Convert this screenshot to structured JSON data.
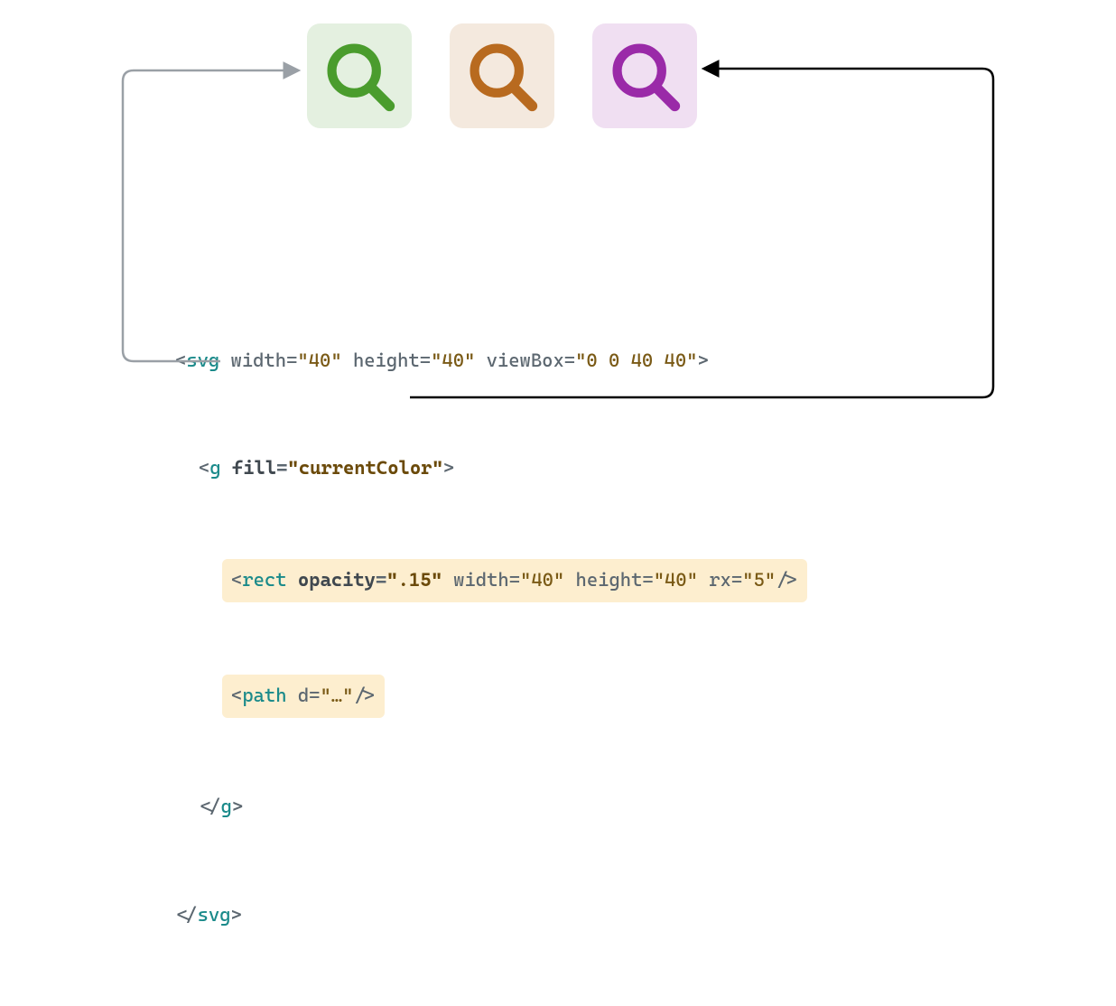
{
  "icons": [
    {
      "name": "search-icon",
      "color": "#4a9c2d"
    },
    {
      "name": "search-icon",
      "color": "#b86a1f"
    },
    {
      "name": "search-icon",
      "color": "#9a2aa8"
    }
  ],
  "code": {
    "svgOpen": {
      "tag": "svg",
      "attrs": [
        {
          "name": "width",
          "value": "40"
        },
        {
          "name": "height",
          "value": "40"
        },
        {
          "name": "viewBox",
          "value": "0 0 40 40"
        }
      ]
    },
    "gOpen": {
      "tag": "g",
      "attrBold": {
        "name": "fill",
        "value": "currentColor"
      }
    },
    "rect": {
      "tag": "rect",
      "attrBold": {
        "name": "opacity",
        "value": ".15"
      },
      "attrs": [
        {
          "name": "width",
          "value": "40"
        },
        {
          "name": "height",
          "value": "40"
        },
        {
          "name": "rx",
          "value": "5"
        }
      ]
    },
    "path": {
      "tag": "path",
      "attrs": [
        {
          "name": "d",
          "value": "…"
        }
      ]
    },
    "gClose": "g",
    "svgClose": "svg"
  },
  "arrows": {
    "grey": "#9aa0a6",
    "black": "#000000"
  }
}
